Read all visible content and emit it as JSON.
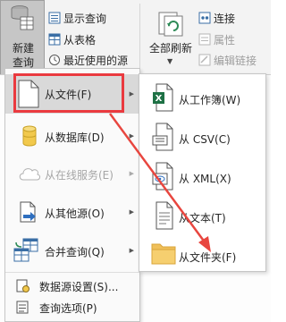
{
  "ribbon": {
    "new_query": {
      "line1": "新建",
      "line2": "查询"
    },
    "show_queries": "显示查询",
    "from_table": "从表格",
    "recent_sources": "最近使用的源",
    "refresh_all": "全部刷新",
    "connections": "连接",
    "properties": "属性",
    "edit_links": "编辑链接"
  },
  "menu": {
    "items": [
      {
        "label": "从文件(F)",
        "icon": "file-doc-icon",
        "highlighted": true
      },
      {
        "label": "从数据库(D)",
        "icon": "database-icon"
      },
      {
        "label": "从在线服务(E)",
        "icon": "cloud-icon",
        "disabled": true
      },
      {
        "label": "从其他源(O)",
        "icon": "other-sources-icon"
      },
      {
        "label": "合并查询(Q)",
        "icon": "combine-query-icon"
      }
    ],
    "bottom_items": [
      {
        "label": "数据源设置(S)...",
        "icon": "data-source-settings-icon"
      },
      {
        "label": "查询选项(P)",
        "icon": "query-options-icon"
      }
    ]
  },
  "submenu": {
    "items": [
      {
        "label": "从工作簿(W)",
        "icon": "excel-workbook-icon"
      },
      {
        "label": "从 CSV(C)",
        "icon": "csv-file-icon"
      },
      {
        "label": "从 XML(X)",
        "icon": "xml-file-icon"
      },
      {
        "label": "从文本(T)",
        "icon": "text-file-icon"
      },
      {
        "label": "从文件夹(F)",
        "icon": "folder-icon"
      }
    ]
  },
  "colors": {
    "highlight_box": "#ea3a3f",
    "arrow": "#e8463f",
    "excel_green": "#1e7145",
    "folder": "#f0c05a"
  }
}
